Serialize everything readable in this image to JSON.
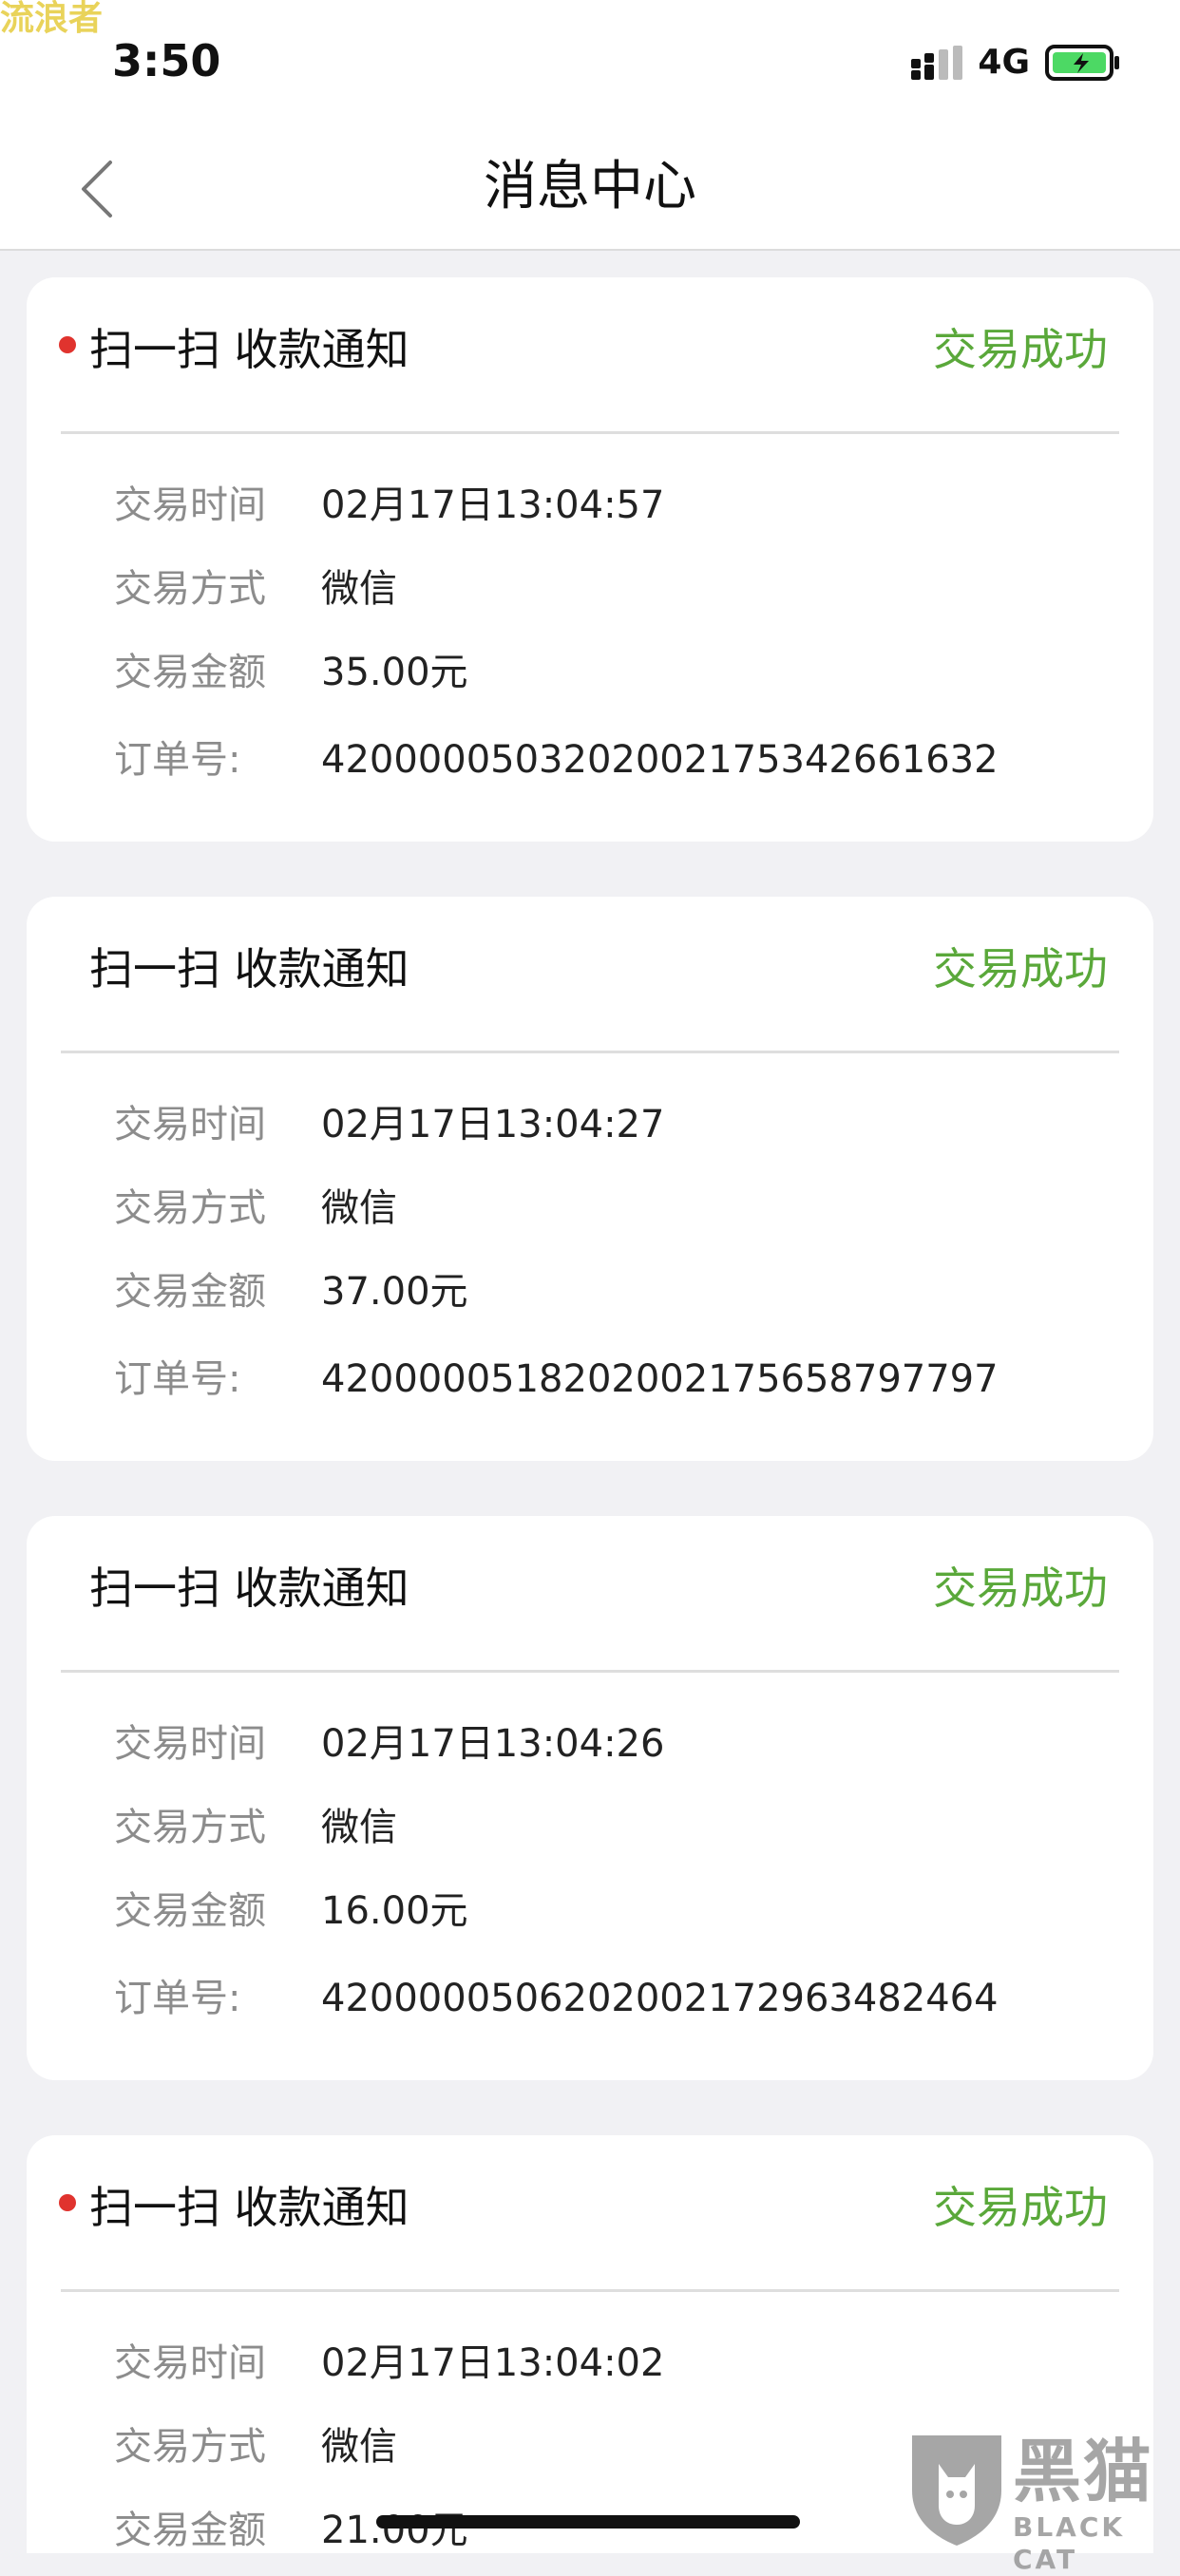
{
  "watermark": "流浪者",
  "status_bar": {
    "time": "3:50",
    "network": "4G"
  },
  "nav": {
    "title": "消息中心"
  },
  "messages": [
    {
      "title": "扫一扫 收款通知",
      "status": "交易成功",
      "unread": true,
      "details": [
        {
          "label": "交易时间",
          "value": "02月17日13:04:57"
        },
        {
          "label": "交易方式",
          "value": "微信"
        },
        {
          "label": "交易金额",
          "value": "35.00元"
        },
        {
          "label": "订单号:",
          "value": "4200000503202002175342661632"
        }
      ]
    },
    {
      "title": "扫一扫 收款通知",
      "status": "交易成功",
      "unread": false,
      "details": [
        {
          "label": "交易时间",
          "value": "02月17日13:04:27"
        },
        {
          "label": "交易方式",
          "value": "微信"
        },
        {
          "label": "交易金额",
          "value": "37.00元"
        },
        {
          "label": "订单号:",
          "value": "4200000518202002175658797797"
        }
      ]
    },
    {
      "title": "扫一扫 收款通知",
      "status": "交易成功",
      "unread": false,
      "details": [
        {
          "label": "交易时间",
          "value": "02月17日13:04:26"
        },
        {
          "label": "交易方式",
          "value": "微信"
        },
        {
          "label": "交易金额",
          "value": "16.00元"
        },
        {
          "label": "订单号:",
          "value": "4200000506202002172963482464"
        }
      ]
    },
    {
      "title": "扫一扫 收款通知",
      "status": "交易成功",
      "unread": true,
      "details": [
        {
          "label": "交易时间",
          "value": "02月17日13:04:02"
        },
        {
          "label": "交易方式",
          "value": "微信"
        },
        {
          "label": "交易金额",
          "value": "21.00元"
        }
      ]
    }
  ],
  "logo": {
    "text": "黑猫",
    "sub": "BLACK CAT"
  },
  "colors": {
    "success": "#5aa83a",
    "unread_dot": "#e0332e",
    "battery": "#4cd964"
  }
}
